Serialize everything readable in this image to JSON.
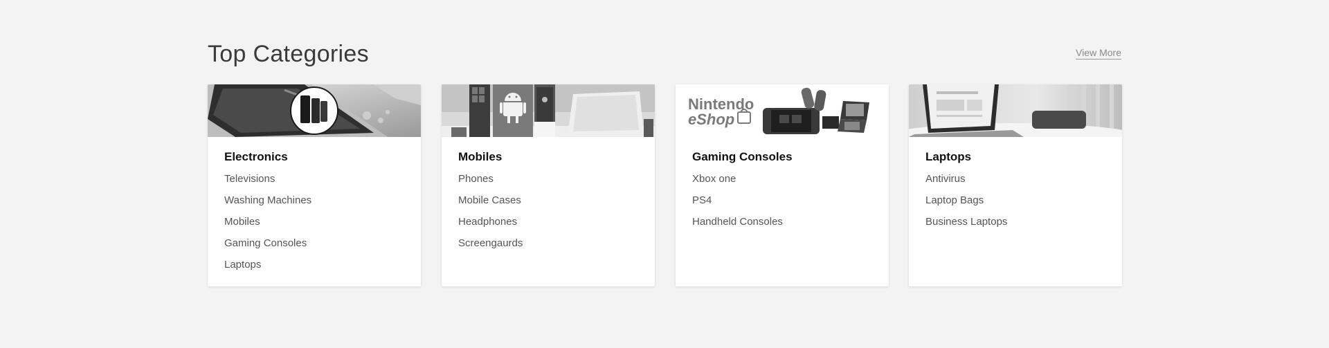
{
  "section": {
    "title": "Top Categories",
    "view_more": "View More"
  },
  "categories": [
    {
      "title": "Electronics",
      "image_icon": "smartphone-with-cases-photo",
      "items": [
        "Televisions",
        "Washing Machines",
        "Mobiles",
        "Gaming Consoles",
        "Laptops"
      ]
    },
    {
      "title": "Mobiles",
      "image_icon": "android-apple-phones-photo",
      "items": [
        "Phones",
        "Mobile Cases",
        "Headphones",
        "Screengaurds"
      ]
    },
    {
      "title": "Gaming Consoles",
      "image_icon": "nintendo-eshop-consoles-photo",
      "banner_text": [
        "Nintendo",
        "eShop"
      ],
      "items": [
        "Xbox one",
        "PS4",
        "Handheld Consoles"
      ]
    },
    {
      "title": "Laptops",
      "image_icon": "laptop-on-desk-photo",
      "items": [
        "Antivirus",
        "Laptop Bags",
        "Business Laptops"
      ]
    }
  ]
}
